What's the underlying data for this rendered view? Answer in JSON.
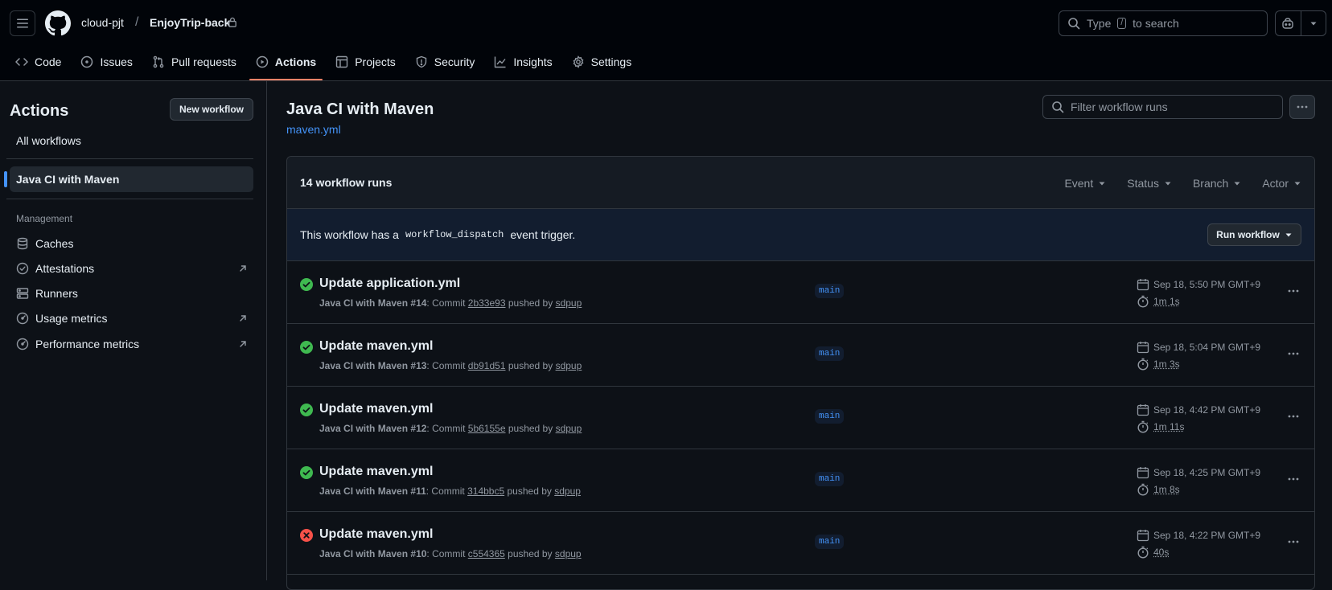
{
  "header": {
    "owner": "cloud-pjt",
    "separator": "/",
    "repo": "EnjoyTrip-back",
    "search": {
      "prefix": "Type",
      "key": "/",
      "suffix": "to search"
    }
  },
  "nav": {
    "tabs": [
      {
        "label": "Code",
        "icon": "code-icon"
      },
      {
        "label": "Issues",
        "icon": "issue-icon"
      },
      {
        "label": "Pull requests",
        "icon": "pull-request-icon"
      },
      {
        "label": "Actions",
        "icon": "play-icon",
        "active": true
      },
      {
        "label": "Projects",
        "icon": "table-icon"
      },
      {
        "label": "Security",
        "icon": "shield-icon"
      },
      {
        "label": "Insights",
        "icon": "graph-icon"
      },
      {
        "label": "Settings",
        "icon": "gear-icon"
      }
    ]
  },
  "sidebar": {
    "title": "Actions",
    "new_workflow": "New workflow",
    "all_workflows": "All workflows",
    "active_workflow": "Java CI with Maven",
    "section": "Management",
    "items": [
      {
        "label": "Caches",
        "icon": "database-icon"
      },
      {
        "label": "Attestations",
        "icon": "verified-icon"
      },
      {
        "label": "Runners",
        "icon": "server-icon"
      },
      {
        "label": "Usage metrics",
        "icon": "meter-icon"
      },
      {
        "label": "Performance metrics",
        "icon": "meter-icon"
      }
    ]
  },
  "main": {
    "title": "Java CI with Maven",
    "file": "maven.yml",
    "filter_placeholder": "Filter workflow runs",
    "runs_count": "14 workflow runs",
    "filters": [
      "Event",
      "Status",
      "Branch",
      "Actor"
    ],
    "dispatch": {
      "before": "This workflow has a",
      "code": "workflow_dispatch",
      "after": "event trigger."
    },
    "run_workflow": "Run workflow",
    "pushed_by": "pushed by",
    "runs": [
      {
        "title": "Update application.yml",
        "workflow": "Java CI with Maven",
        "number": "#14",
        "commit_label": "Commit",
        "commit": "2b33e93",
        "user": "sdpup",
        "branch": "main",
        "date": "Sep 18, 5:50 PM GMT+9",
        "duration": "1m 1s",
        "status": "success"
      },
      {
        "title": "Update maven.yml",
        "workflow": "Java CI with Maven",
        "number": "#13",
        "commit_label": "Commit",
        "commit": "db91d51",
        "user": "sdpup",
        "branch": "main",
        "date": "Sep 18, 5:04 PM GMT+9",
        "duration": "1m 3s",
        "status": "success"
      },
      {
        "title": "Update maven.yml",
        "workflow": "Java CI with Maven",
        "number": "#12",
        "commit_label": "Commit",
        "commit": "5b6155e",
        "user": "sdpup",
        "branch": "main",
        "date": "Sep 18, 4:42 PM GMT+9",
        "duration": "1m 11s",
        "status": "success"
      },
      {
        "title": "Update maven.yml",
        "workflow": "Java CI with Maven",
        "number": "#11",
        "commit_label": "Commit",
        "commit": "314bbc5",
        "user": "sdpup",
        "branch": "main",
        "date": "Sep 18, 4:25 PM GMT+9",
        "duration": "1m 8s",
        "status": "success"
      },
      {
        "title": "Update maven.yml",
        "workflow": "Java CI with Maven",
        "number": "#10",
        "commit_label": "Commit",
        "commit": "c554365",
        "user": "sdpup",
        "branch": "main",
        "date": "Sep 18, 4:22 PM GMT+9",
        "duration": "40s",
        "status": "failure"
      }
    ]
  },
  "colors": {
    "accent": "#4493f8",
    "success": "#3fb950",
    "failure": "#f85149",
    "active_tab": "#f78166",
    "background": "#0d1117"
  }
}
